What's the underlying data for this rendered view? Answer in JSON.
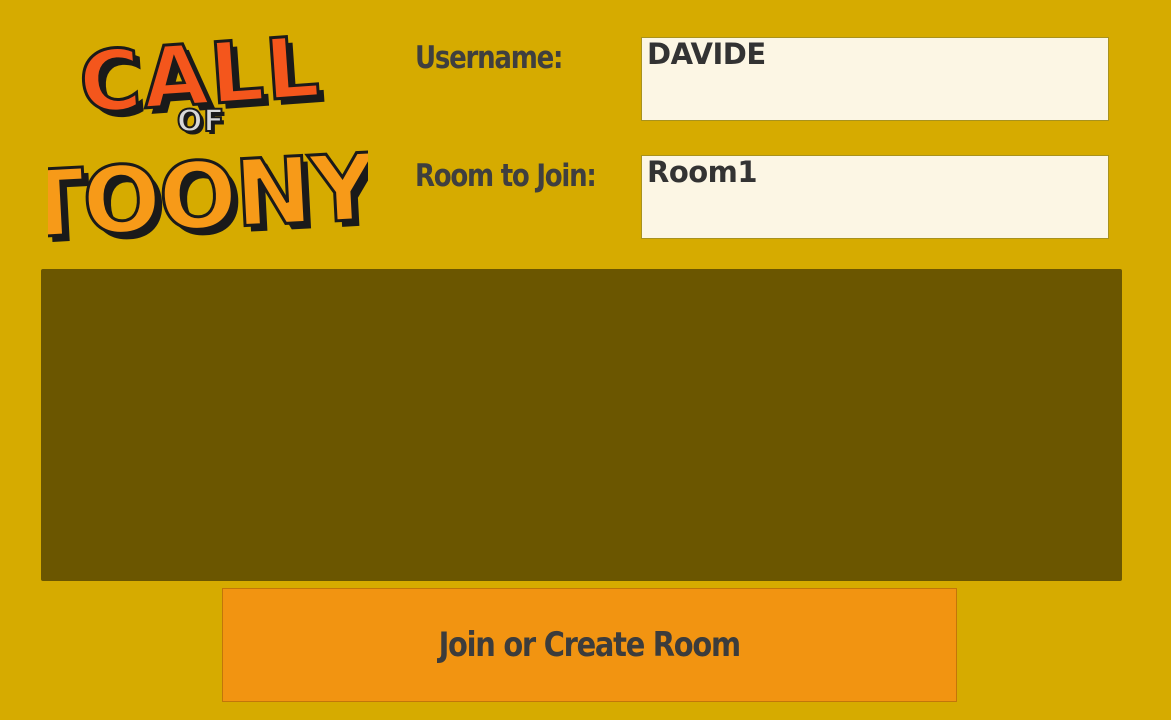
{
  "logo": {
    "line1": "CALL",
    "line2": "OF",
    "line3": "TOONY",
    "colors": {
      "top": "#f4561c",
      "middle": "#d8d8d8",
      "bottom": "#f79a18",
      "outline": "#1a1a1a"
    }
  },
  "form": {
    "username_label": "Username:",
    "username_value": "DAVIDE",
    "room_label": "Room to Join:",
    "room_value": "Room1"
  },
  "join_button": {
    "label": "Join or Create Room"
  },
  "colors": {
    "background": "#d6ab00",
    "panel": "#6b5600",
    "input": "#fcf6e4",
    "button": "#f29411",
    "text": "#3f3f3f"
  }
}
